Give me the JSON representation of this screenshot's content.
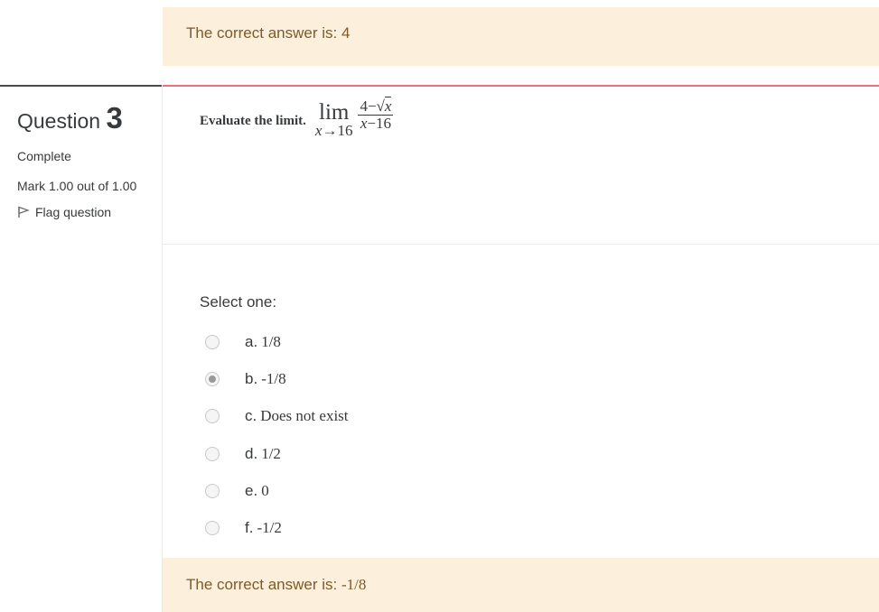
{
  "prev_feedback": {
    "prefix": "The correct answer is: ",
    "value": "4"
  },
  "question": {
    "label": "Question",
    "number": "3",
    "state": "Complete",
    "grade": "Mark 1.00 out of 1.00",
    "flag_label": "Flag question",
    "text": "Evaluate the limit.",
    "math": {
      "lim": "lim",
      "sub_var": "x",
      "sub_arrow": "→",
      "sub_value": "16",
      "num_a": "4−",
      "num_var": "x",
      "den_var": "x",
      "den_b": "−16"
    }
  },
  "select_label": "Select one:",
  "answers": [
    {
      "letter": "a.",
      "text": "1/8",
      "checked": false
    },
    {
      "letter": "b.",
      "text": "-1/8",
      "checked": true
    },
    {
      "letter": "c.",
      "text": "Does not exist",
      "checked": false
    },
    {
      "letter": "d.",
      "text": "1/2",
      "checked": false
    },
    {
      "letter": "e.",
      "text": "0",
      "checked": false
    },
    {
      "letter": "f.",
      "text": "-1/2",
      "checked": false
    }
  ],
  "feedback": {
    "prefix": "The correct answer is: ",
    "value": "-1/8"
  }
}
